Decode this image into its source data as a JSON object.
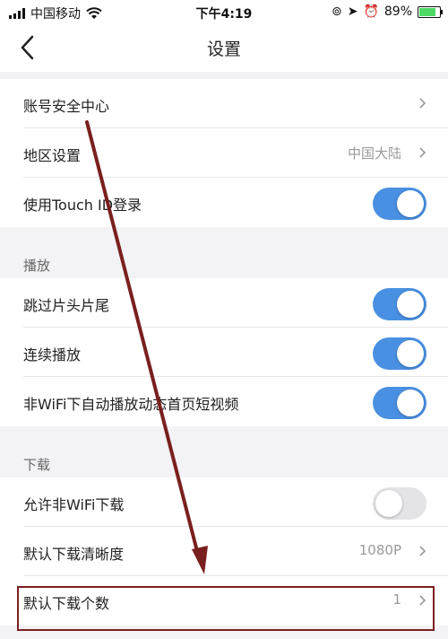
{
  "status_bar": {
    "carrier": "中国移动",
    "time": "下午4:19",
    "battery": "89%",
    "battery_level": 0.89
  },
  "nav": {
    "title": "设置"
  },
  "rows": {
    "account_security": {
      "label": "账号安全中心"
    },
    "region": {
      "label": "地区设置",
      "value": "中国大陆"
    },
    "touch_id": {
      "label": "使用Touch ID登录",
      "on": true
    },
    "skip_intro": {
      "label": "跳过片头片尾",
      "on": true
    },
    "continuous_play": {
      "label": "连续播放",
      "on": true
    },
    "non_wifi_autoplay": {
      "label": "非WiFi下自动播放动态首页短视频",
      "on": true
    },
    "non_wifi_download": {
      "label": "允许非WiFi下载",
      "on": false
    },
    "download_quality": {
      "label": "默认下载清晰度",
      "value": "1080P"
    },
    "download_count": {
      "label": "默认下载个数",
      "value": "1"
    }
  },
  "sections": {
    "playback": "播放",
    "download": "下载"
  },
  "colors": {
    "toggle_on": "#4a90e2",
    "annotation": "#7a1f1f"
  }
}
